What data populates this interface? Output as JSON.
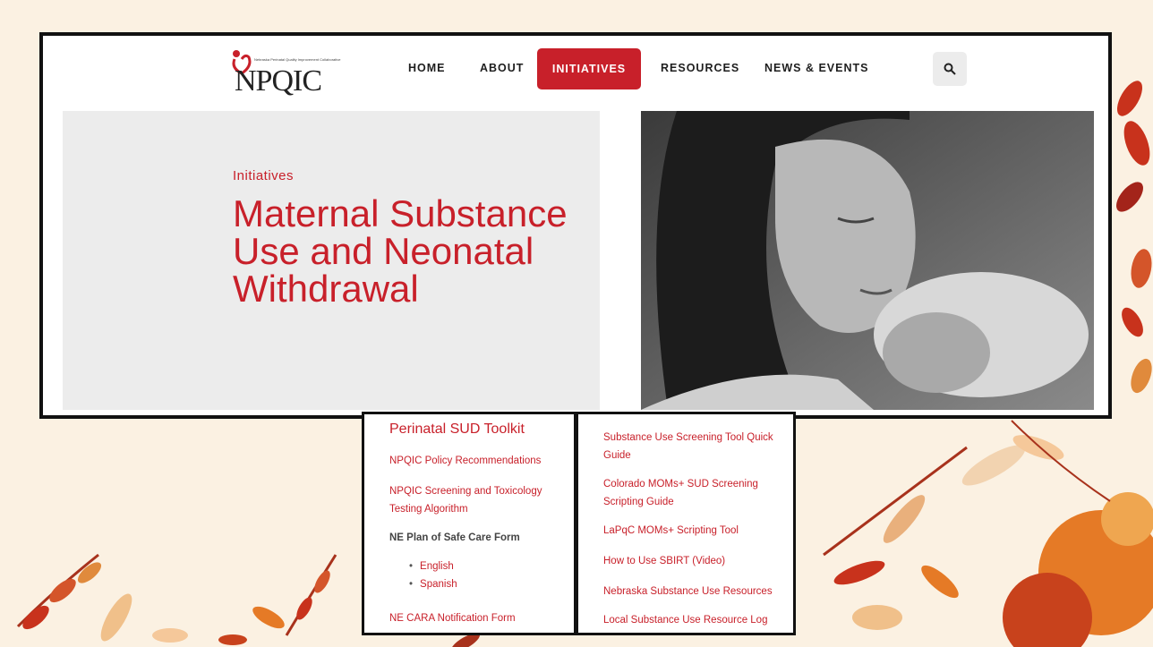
{
  "nav": {
    "logo_text": "NPQIC",
    "logo_tagline": "Nebraska Perinatal Quality Improvement Collaborative",
    "items": [
      "HOME",
      "ABOUT",
      "INITIATIVES",
      "RESOURCES",
      "NEWS & EVENTS"
    ],
    "active_index": 2,
    "search_icon": "search-icon"
  },
  "hero": {
    "eyebrow": "Initiatives",
    "title": "Maternal Substance Use and Neonatal Withdrawal",
    "photo": "black-and-white mother holding newborn"
  },
  "toolkit": {
    "title": "Perinatal SUD Toolkit",
    "left_links": [
      "NPQIC Policy Recommendations",
      "NPQIC Screening and Toxicology Testing Algorithm"
    ],
    "safe_care_heading": "NE Plan of Safe Care Form",
    "safe_care_options": [
      "English",
      "Spanish"
    ],
    "cara_link": "NE CARA Notification Form",
    "right_links": [
      "Substance Use Screening Tool Quick Guide",
      "Colorado MOMs+ SUD Screening Scripting Guide",
      "LaPqC MOMs+ Scripting Tool",
      "How to Use SBIRT (Video)",
      "Nebraska Substance Use Resources",
      "Local Substance Use Resource Log"
    ]
  },
  "colors": {
    "brand_red": "#c8202a",
    "background": "#fbf1e2",
    "hero_gray": "#ececec"
  }
}
